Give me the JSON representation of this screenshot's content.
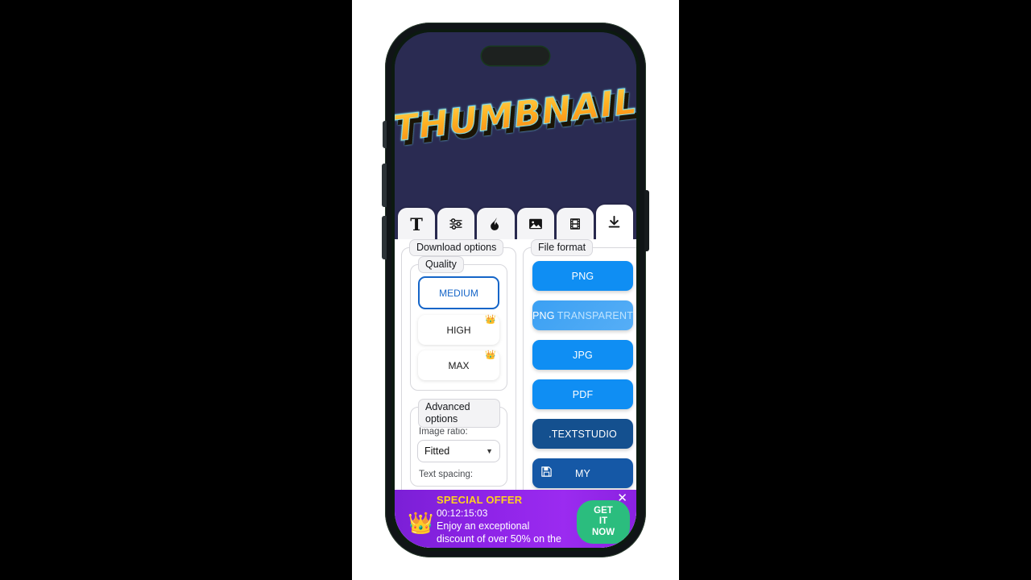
{
  "canvas": {
    "thumbnail_text": "THUMBNAIL",
    "background_color": "#2a2b52",
    "text_gradient_from": "#ffd04a",
    "text_gradient_to": "#f98a17",
    "text_outline_color": "#7fe3f5"
  },
  "toolbar": {
    "tabs": [
      {
        "name": "text",
        "icon": "text-tool-icon",
        "glyph": "T",
        "active": false
      },
      {
        "name": "adjustments",
        "icon": "sliders-icon",
        "active": false
      },
      {
        "name": "effects",
        "icon": "flame-icon",
        "active": false
      },
      {
        "name": "image",
        "icon": "image-icon",
        "active": false
      },
      {
        "name": "video",
        "icon": "film-icon",
        "active": false
      },
      {
        "name": "download",
        "icon": "download-icon",
        "active": true
      }
    ]
  },
  "download_options": {
    "legend": "Download options",
    "quality": {
      "legend": "Quality",
      "options": [
        {
          "label": "MEDIUM",
          "selected": true,
          "premium": false
        },
        {
          "label": "HIGH",
          "selected": false,
          "premium": true
        },
        {
          "label": "MAX",
          "selected": false,
          "premium": true
        }
      ],
      "selected_color": "#1565c8",
      "crown_color": "#f0b000"
    },
    "advanced": {
      "legend": "Advanced options",
      "image_ratio_label": "Image ratio:",
      "image_ratio_value": "Fitted",
      "text_spacing_label": "Text spacing:"
    }
  },
  "file_format": {
    "legend": "File format",
    "buttons": [
      {
        "label": "PNG",
        "sub": "",
        "color": "#0f8ef3",
        "icon": ""
      },
      {
        "label": "PNG",
        "sub": "TRANSPARENT",
        "color": "#56aef6",
        "icon": ""
      },
      {
        "label": "JPG",
        "sub": "",
        "color": "#0f8ef3",
        "icon": ""
      },
      {
        "label": "PDF",
        "sub": "",
        "color": "#0f8ef3",
        "icon": ""
      },
      {
        "label": ".TEXTSTUDIO",
        "sub": "",
        "color": "#14508f",
        "icon": ""
      },
      {
        "label": "MY",
        "sub": "",
        "color": "#1558a6",
        "icon": "floppy-disk-icon"
      }
    ]
  },
  "promo_banner": {
    "crown_icon": "crown-icon",
    "title": "SPECIAL OFFER",
    "timer": "00:12:15:03",
    "description_line_1": "Enjoy an exceptional",
    "description_line_2": "discount of over 50% on the",
    "cta_line_1": "GET",
    "cta_line_2": "IT",
    "cta_line_3": "NOW",
    "close_label": "✕",
    "background_color": "#8f24e8",
    "cta_color": "#2bbd7e",
    "title_color": "#ffd21e"
  }
}
